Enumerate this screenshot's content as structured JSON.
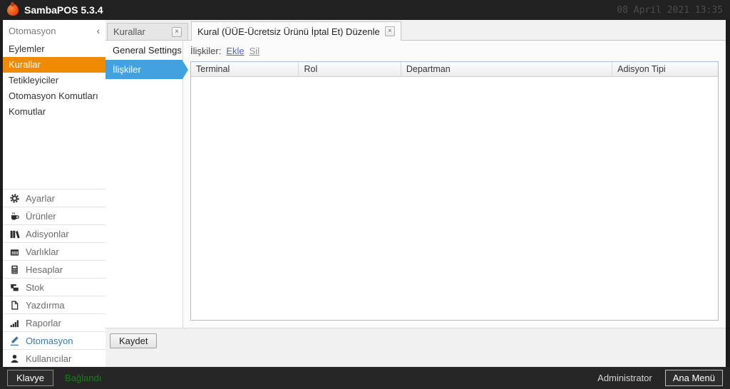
{
  "titlebar": {
    "app_title": "SambaPOS 5.3.4",
    "datetime": "08 April 2021 13:35"
  },
  "sidebar": {
    "header": "Otomasyon",
    "collapse_icon": "‹",
    "nav_items": [
      {
        "label": "Eylemler"
      },
      {
        "label": "Kurallar",
        "active": true
      },
      {
        "label": "Tetikleyiciler"
      },
      {
        "label": "Otomasyon Komutları"
      },
      {
        "label": "Komutlar"
      }
    ],
    "modules": [
      {
        "label": "Ayarlar",
        "icon": "gear-icon"
      },
      {
        "label": "Ürünler",
        "icon": "coffee-cup-icon"
      },
      {
        "label": "Adisyonlar",
        "icon": "books-icon"
      },
      {
        "label": "Varlıklar",
        "icon": "cash-register-icon"
      },
      {
        "label": "Hesaplar",
        "icon": "calculator-icon"
      },
      {
        "label": "Stok",
        "icon": "boxes-icon"
      },
      {
        "label": "Yazdırma",
        "icon": "document-icon"
      },
      {
        "label": "Raporlar",
        "icon": "bar-chart-icon"
      },
      {
        "label": "Otomasyon",
        "icon": "pencil-icon",
        "selected": true
      },
      {
        "label": "Kullanıcılar",
        "icon": "person-icon"
      }
    ]
  },
  "tabs": [
    {
      "label": "Kurallar",
      "close_icon": "×"
    },
    {
      "label": "Kural (ÜÜE-Ücretsiz Ürünü İptal Et) Düzenle",
      "close_icon": "×",
      "active": true
    }
  ],
  "settings_panel": {
    "items": [
      {
        "label": "General Settings"
      },
      {
        "label": "İlişkiler",
        "selected": true
      }
    ]
  },
  "content": {
    "relations_label": "İlişkiler:",
    "add_link": "Ekle",
    "delete_link": "Sil",
    "table": {
      "columns": [
        "Terminal",
        "Rol",
        "Departman",
        "Adisyon Tipi"
      ],
      "rows": []
    }
  },
  "page_footer": {
    "save_label": "Kaydet"
  },
  "statusbar": {
    "keyboard_label": "Klavye",
    "connection_status": "Bağlandı",
    "user": "Administrator",
    "main_menu_label": "Ana Menü"
  },
  "colors": {
    "accent_orange": "#F08A00",
    "accent_blue": "#42A1DE",
    "connected_green": "#1E7A1E",
    "titlebar_bg": "#212121"
  }
}
